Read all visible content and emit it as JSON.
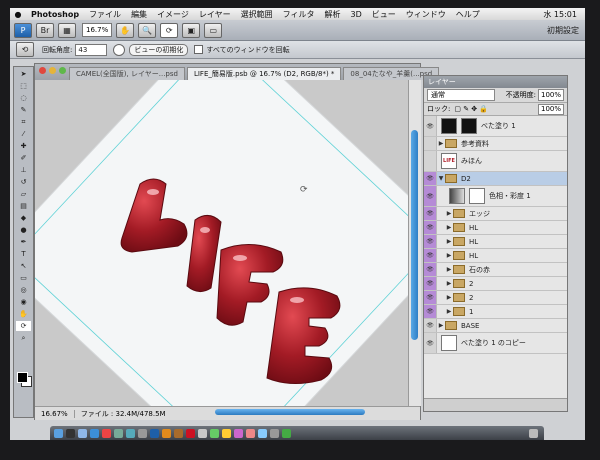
{
  "menubar": {
    "app": "Photoshop",
    "items": [
      "ファイル",
      "編集",
      "イメージ",
      "レイヤー",
      "選択範囲",
      "フィルタ",
      "解析",
      "3D",
      "ビュー",
      "ウィンドウ",
      "ヘルプ"
    ],
    "clock": "水 15:01"
  },
  "appbar": {
    "zoom": "16.7%",
    "workspace": "初期設定"
  },
  "options": {
    "rotate_label": "回転角度:",
    "rotate_value": "43",
    "reset_view_label": "ビューの初期化",
    "all_windows_label": "すべてのウィンドウを回転"
  },
  "document": {
    "tabs": [
      "CAMEL(全国版), レイヤー...psd",
      "LIFE_簡易版.psb @ 16.7% (D2, RGB/8*) *",
      "08_04たなや_羊羹(...psd"
    ],
    "title": "LIFE_簡易版.psb @ 16.7% (D2, RGB/8*)",
    "artwork_text": "LIFE",
    "status_zoom": "16.67%",
    "status_file": "ファイル : 32.4M/478.5M"
  },
  "layers_panel": {
    "title": "レイヤー",
    "blend_mode": "通常",
    "opacity_label": "不透明度:",
    "opacity": "100%",
    "lock_label": "ロック:",
    "fill_label": "塗り:",
    "fill": "100%",
    "layers": [
      {
        "name": "べた塗り 1",
        "kind": "fill",
        "indent": 0,
        "selected": false,
        "visible": true
      },
      {
        "name": "参考資料",
        "kind": "folder",
        "indent": 0,
        "selected": false,
        "visible": false
      },
      {
        "name": "みほん",
        "kind": "thumb",
        "indent": 0,
        "selected": false,
        "visible": false
      },
      {
        "name": "D2",
        "kind": "folder",
        "indent": 0,
        "selected": true,
        "visible": true
      },
      {
        "name": "色相・彩度 1",
        "kind": "adjust",
        "indent": 1,
        "selected": false,
        "visible": true
      },
      {
        "name": "エッジ",
        "kind": "folder",
        "indent": 1,
        "selected": false,
        "visible": true
      },
      {
        "name": "HL",
        "kind": "folder",
        "indent": 1,
        "selected": false,
        "visible": true
      },
      {
        "name": "HL",
        "kind": "folder",
        "indent": 1,
        "selected": false,
        "visible": true
      },
      {
        "name": "HL",
        "kind": "folder",
        "indent": 1,
        "selected": false,
        "visible": true
      },
      {
        "name": "石の赤",
        "kind": "folder",
        "indent": 1,
        "selected": false,
        "visible": true
      },
      {
        "name": "2",
        "kind": "folder",
        "indent": 1,
        "selected": false,
        "visible": true
      },
      {
        "name": "2",
        "kind": "folder",
        "indent": 1,
        "selected": false,
        "visible": true
      },
      {
        "name": "1",
        "kind": "folder",
        "indent": 1,
        "selected": false,
        "visible": true
      },
      {
        "name": "BASE",
        "kind": "folder",
        "indent": 0,
        "selected": false,
        "visible": true
      },
      {
        "name": "べた塗り 1 のコピー",
        "kind": "thumb",
        "indent": 0,
        "selected": false,
        "visible": true
      }
    ]
  },
  "colors": {
    "accent": "#3b86d4",
    "artwork_red": "#a11a24",
    "layer_eye_purple": "#b58bd6"
  }
}
